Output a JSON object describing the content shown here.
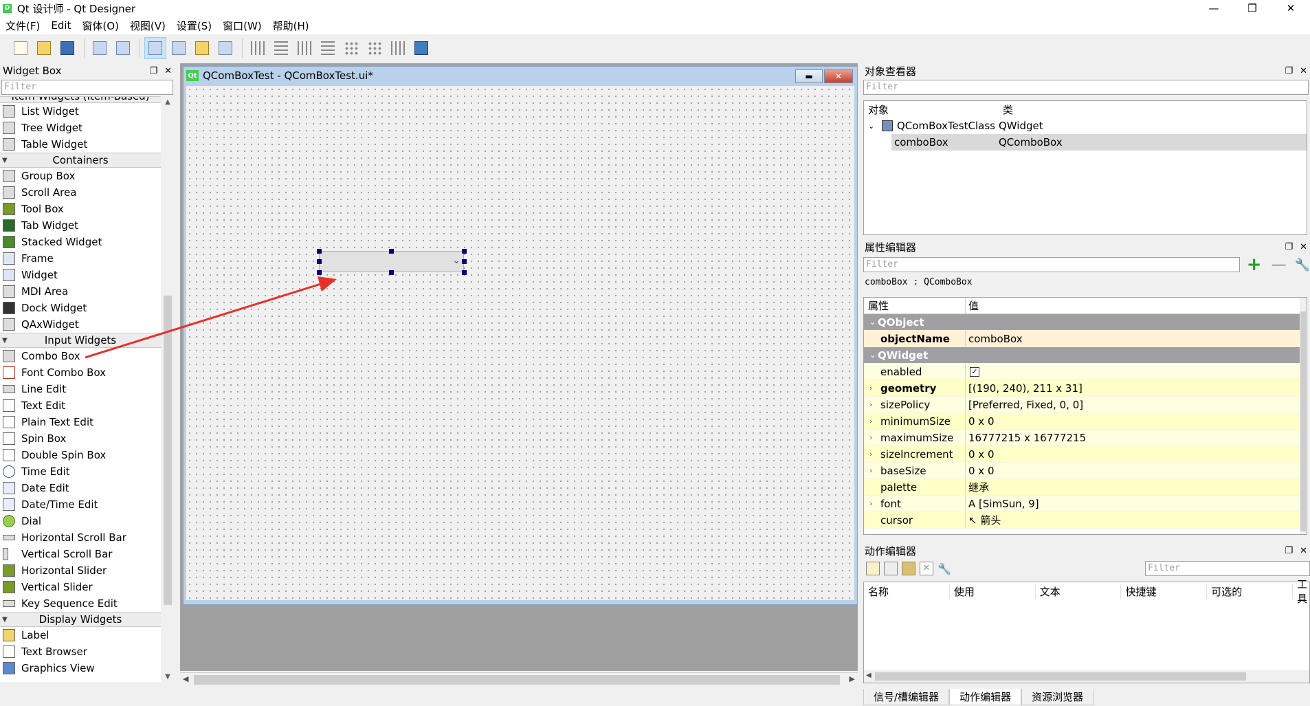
{
  "window": {
    "title": "Qt 设计师 - Qt Designer",
    "controls": [
      "—",
      "❐",
      "✕"
    ]
  },
  "menu": [
    "文件(F)",
    "Edit",
    "窗体(O)",
    "视图(V)",
    "设置(S)",
    "窗口(W)",
    "帮助(H)"
  ],
  "widgetbox": {
    "title": "Widget Box",
    "filter_placeholder": "Filter",
    "top_partial": "Item Widgets (Item-Based)",
    "items_top": [
      "List Widget",
      "Tree Widget",
      "Table Widget"
    ],
    "categories": [
      {
        "name": "Containers",
        "items": [
          "Group Box",
          "Scroll Area",
          "Tool Box",
          "Tab Widget",
          "Stacked Widget",
          "Frame",
          "Widget",
          "MDI Area",
          "Dock Widget",
          "QAxWidget"
        ]
      },
      {
        "name": "Input Widgets",
        "items": [
          "Combo Box",
          "Font Combo Box",
          "Line Edit",
          "Text Edit",
          "Plain Text Edit",
          "Spin Box",
          "Double Spin Box",
          "Time Edit",
          "Date Edit",
          "Date/Time Edit",
          "Dial",
          "Horizontal Scroll Bar",
          "Vertical Scroll Bar",
          "Horizontal Slider",
          "Vertical Slider",
          "Key Sequence Edit"
        ]
      },
      {
        "name": "Display Widgets",
        "items": [
          "Label",
          "Text Browser",
          "Graphics View"
        ]
      }
    ]
  },
  "form": {
    "title": "QComBoxTest - QComBoxTest.ui*",
    "qt_badge": "Qt"
  },
  "object_inspector": {
    "title": "对象查看器",
    "filter_placeholder": "Filter",
    "col_object": "对象",
    "col_class": "类",
    "rows": [
      {
        "object": "QComBoxTestClass",
        "class": "QWidget"
      },
      {
        "object": "comboBox",
        "class": "QComboBox"
      }
    ]
  },
  "property_editor": {
    "title": "属性编辑器",
    "filter_placeholder": "Filter",
    "object_label": "comboBox : QComboBox",
    "col_property": "属性",
    "col_value": "值",
    "groups": [
      {
        "name": "QObject",
        "props": [
          {
            "name": "objectName",
            "value": "comboBox"
          }
        ]
      },
      {
        "name": "QWidget",
        "props": [
          {
            "name": "enabled",
            "value": "✓"
          },
          {
            "name": "geometry",
            "value": "[(190, 240), 211 x 31]"
          },
          {
            "name": "sizePolicy",
            "value": "[Preferred, Fixed, 0, 0]"
          },
          {
            "name": "minimumSize",
            "value": "0 x 0"
          },
          {
            "name": "maximumSize",
            "value": "16777215 x 16777215"
          },
          {
            "name": "sizeIncrement",
            "value": "0 x 0"
          },
          {
            "name": "baseSize",
            "value": "0 x 0"
          },
          {
            "name": "palette",
            "value": "继承"
          },
          {
            "name": "font",
            "value": "A  [SimSun, 9]"
          },
          {
            "name": "cursor",
            "value": "↖  箭头"
          }
        ]
      }
    ]
  },
  "action_editor": {
    "title": "动作编辑器",
    "filter_placeholder": "Filter",
    "columns": [
      "名称",
      "使用",
      "文本",
      "快捷键",
      "可选的",
      "工具"
    ]
  },
  "bottom_tabs": [
    "信号/槽编辑器",
    "动作编辑器",
    "资源浏览器"
  ],
  "colors": {
    "group_header": "#a0a0a4",
    "prop_yellow": "#ffffc8",
    "selection": "#d9d9d9",
    "annotation_arrow": "#e8302a",
    "qt_green": "#41cd52"
  }
}
